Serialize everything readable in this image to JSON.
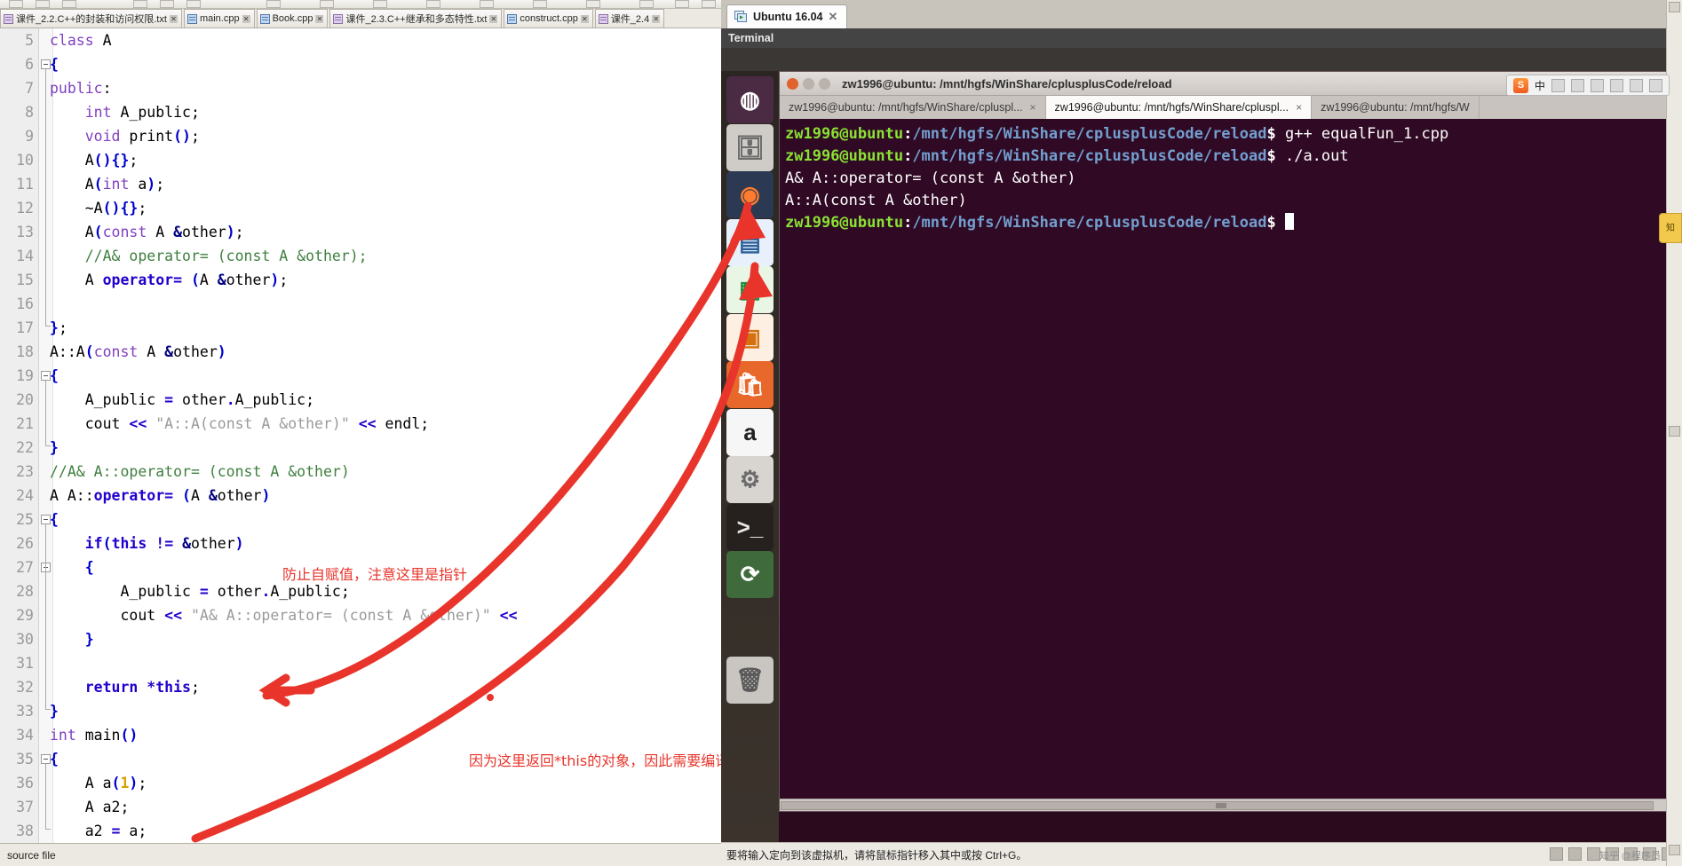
{
  "editor": {
    "tabs": [
      {
        "label": "课件_2.2.C++的封装和访问权限.txt",
        "type": "txt"
      },
      {
        "label": "main.cpp",
        "type": "cpp"
      },
      {
        "label": "Book.cpp",
        "type": "cpp"
      },
      {
        "label": "课件_2.3.C++继承和多态特性.txt",
        "type": "txt"
      },
      {
        "label": "construct.cpp",
        "type": "cpp"
      },
      {
        "label": "课件_2.4",
        "type": "txt"
      }
    ],
    "status": "source file",
    "first_line_number": 5,
    "lines": [
      {
        "n": 5,
        "text": "class A"
      },
      {
        "n": 6,
        "text": "{"
      },
      {
        "n": 7,
        "text": "public:"
      },
      {
        "n": 8,
        "text": "    int A_public;"
      },
      {
        "n": 9,
        "text": "    void print();"
      },
      {
        "n": 10,
        "text": "    A(){};"
      },
      {
        "n": 11,
        "text": "    A(int a);"
      },
      {
        "n": 12,
        "text": "    ~A(){};"
      },
      {
        "n": 13,
        "text": "    A(const A &other);"
      },
      {
        "n": 14,
        "text": "    //A& operator= (const A &other);"
      },
      {
        "n": 15,
        "text": "    A operator= (A &other);"
      },
      {
        "n": 16,
        "text": ""
      },
      {
        "n": 17,
        "text": "};"
      },
      {
        "n": 18,
        "text": "A::A(const A &other)"
      },
      {
        "n": 19,
        "text": "{"
      },
      {
        "n": 20,
        "text": "    A_public = other.A_public;"
      },
      {
        "n": 21,
        "text": "    cout << \"A::A(const A &other)\" << endl;"
      },
      {
        "n": 22,
        "text": "}"
      },
      {
        "n": 23,
        "text": "//A& A::operator= (const A &other)"
      },
      {
        "n": 24,
        "text": "A A::operator= (A &other)"
      },
      {
        "n": 25,
        "text": "{"
      },
      {
        "n": 26,
        "text": "    if(this != &other)"
      },
      {
        "n": 27,
        "text": "    {"
      },
      {
        "n": 28,
        "text": "        A_public = other.A_public;"
      },
      {
        "n": 29,
        "text": "        cout << \"A& A::operator= (const A &other)\" <<"
      },
      {
        "n": 30,
        "text": "    }"
      },
      {
        "n": 31,
        "text": ""
      },
      {
        "n": 32,
        "text": "    return *this;"
      },
      {
        "n": 33,
        "text": "}"
      },
      {
        "n": 34,
        "text": "int main()"
      },
      {
        "n": 35,
        "text": "{"
      },
      {
        "n": 36,
        "text": "    A a(1);"
      },
      {
        "n": 37,
        "text": "    A a2;"
      },
      {
        "n": 38,
        "text": "    a2 = a;"
      }
    ],
    "annotations": [
      {
        "id": "note-self-assign",
        "text": "防止自赋值，注意这里是指针",
        "color": "#e8342a"
      },
      {
        "id": "note-return-this",
        "text": "因为这里返回*this的对象，因此需要编译器从存放*this的地方拷贝一个临时对象存放到函数返回管理的帧栈中",
        "color": "#e8342a"
      }
    ]
  },
  "vmware": {
    "tab_title": "Ubuntu 16.04",
    "tab_close": "✕",
    "menu_label": "Terminal",
    "status_hint": "要将输入定向到该虚拟机，请将鼠标指针移入其中或按 Ctrl+G。"
  },
  "ime": {
    "logo": "S",
    "mode": "中",
    "items": [
      "中",
      "，",
      "☺",
      "🎤",
      "⌨",
      "✂",
      "🗑",
      "⚙"
    ]
  },
  "launcher": {
    "items": [
      {
        "name": "ubuntu-dash-icon",
        "glyph": "◍",
        "bg": "#4a2b43",
        "fg": "#ffffff"
      },
      {
        "name": "files-icon",
        "glyph": "🗄",
        "bg": "#cfcbc6",
        "fg": "#6b6b6b"
      },
      {
        "name": "firefox-icon",
        "glyph": "◉",
        "bg": "#2b3a52",
        "fg": "#ff7b2e"
      },
      {
        "name": "libreoffice-writer-icon",
        "glyph": "▤",
        "bg": "#e8f0fb",
        "fg": "#2a6099"
      },
      {
        "name": "libreoffice-calc-icon",
        "glyph": "▦",
        "bg": "#e9f6e6",
        "fg": "#1d8a3a"
      },
      {
        "name": "libreoffice-impress-icon",
        "glyph": "▣",
        "bg": "#fdf0e2",
        "fg": "#d4700f"
      },
      {
        "name": "ubuntu-software-icon",
        "glyph": "🛍",
        "bg": "#e8672a",
        "fg": "#ffffff"
      },
      {
        "name": "amazon-icon",
        "glyph": "a",
        "bg": "#f6f6f6",
        "fg": "#222222"
      },
      {
        "name": "system-settings-icon",
        "glyph": "⚙",
        "bg": "#d8d4cf",
        "fg": "#6b6b6b"
      },
      {
        "name": "terminal-icon",
        "glyph": ">_",
        "bg": "#26211f",
        "fg": "#e8e8e8"
      },
      {
        "name": "software-updater-icon",
        "glyph": "⟳",
        "bg": "#3f6b3c",
        "fg": "#ffffff"
      },
      {
        "name": "trash-icon",
        "glyph": "🗑",
        "bg": "#c9c5c0",
        "fg": "#5a5a5a"
      }
    ]
  },
  "terminal": {
    "window_title": "zw1996@ubuntu: /mnt/hgfs/WinShare/cplusplusCode/reload",
    "tabs": [
      {
        "label": "zw1996@ubuntu: /mnt/hgfs/WinShare/cpluspl...",
        "active": false,
        "close": "×"
      },
      {
        "label": "zw1996@ubuntu: /mnt/hgfs/WinShare/cpluspl...",
        "active": true,
        "close": "×"
      },
      {
        "label": "zw1996@ubuntu: /mnt/hgfs/W",
        "active": false,
        "close": ""
      }
    ],
    "prompt_user": "zw1996@ubuntu",
    "prompt_path": "/mnt/hgfs/WinShare/cplusplusCode/reload",
    "lines": [
      {
        "type": "prompt",
        "command": " g++ equalFun_1.cpp"
      },
      {
        "type": "prompt",
        "command": " ./a.out"
      },
      {
        "type": "output",
        "text": "A& A::operator= (const A &other)"
      },
      {
        "type": "output",
        "text": "A::A(const A &other)"
      },
      {
        "type": "prompt",
        "command": " ",
        "cursor": true
      }
    ]
  },
  "watermark": "知乎 @程序员"
}
